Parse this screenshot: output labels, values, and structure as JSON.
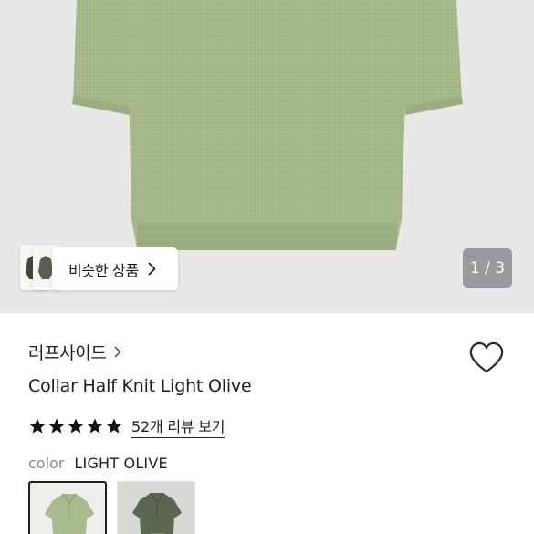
{
  "gallery": {
    "similar_button_label": "비슷한 상품",
    "pager_text": "1 / 3",
    "images_total": 3,
    "images_current": 1
  },
  "product": {
    "brand": "러프사이드",
    "title": "Collar Half Knit Light Olive",
    "rating_stars": 5,
    "reviews_link": "52개 리뷰 보기",
    "color_label": "color",
    "color_value": "LIGHT OLIVE",
    "swatches": [
      "LIGHT OLIVE",
      "DARK OLIVE"
    ]
  },
  "colors": {
    "gallery_bg": "#e8e8e9",
    "knit_light_olive": "#a6b88a",
    "knit_dark_olive": "#5c6650",
    "pager_bg": "#9a9a9c",
    "text_primary": "#1f1f1f"
  },
  "icons": {
    "similar_chevron": "chevron-right-icon",
    "brand_chevron": "chevron-right-icon",
    "wishlist": "heart-outline-icon",
    "rating": "star-filled-icon"
  }
}
